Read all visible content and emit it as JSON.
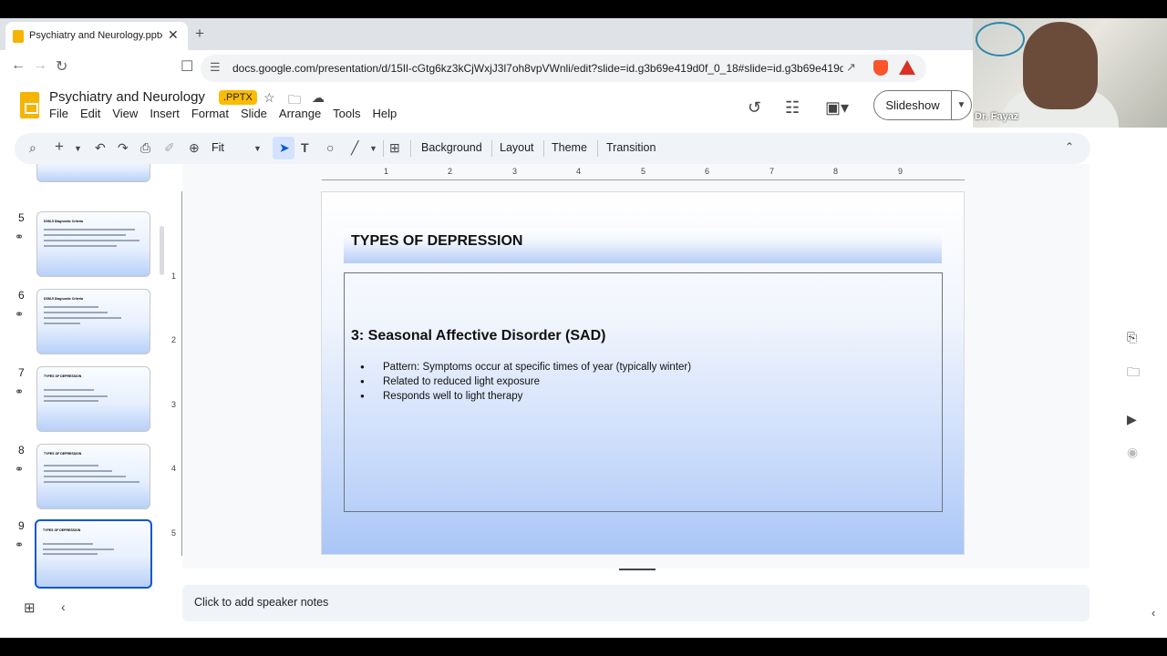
{
  "browser": {
    "tab_title": "Psychiatry and Neurology.pptx",
    "new_tab": "+",
    "close": "✕",
    "url": "docs.google.com/presentation/d/15Il-cGtg6kz3kCjWxjJ3l7oh8vpVWnli/edit?slide=id.g3b69e419d0f_0_18#slide=id.g3b69e419d...",
    "icons": [
      "back-icon",
      "forward-icon",
      "reload-icon",
      "bookmark-icon",
      "site-settings-icon",
      "share-icon",
      "brave-shields-icon",
      "brave-rewards-icon"
    ]
  },
  "docs": {
    "title": "Psychiatry and Neurology",
    "badge": ".PPTX",
    "menu": [
      "File",
      "Edit",
      "View",
      "Insert",
      "Format",
      "Slide",
      "Arrange",
      "Tools",
      "Help"
    ],
    "slideshow_label": "Slideshow"
  },
  "webcam": {
    "name": "Dr. Fayaz"
  },
  "toolbar": {
    "zoom": "Fit",
    "background": "Background",
    "layout": "Layout",
    "theme": "Theme",
    "transition": "Transition"
  },
  "filmstrip": {
    "slides": [
      {
        "num": "5",
        "title": "DSM-5 Diagnostic Criteria"
      },
      {
        "num": "6",
        "title": "DSM-5 Diagnostic Criteria"
      },
      {
        "num": "7",
        "title": "TYPES OF DEPRESSION"
      },
      {
        "num": "8",
        "title": "TYPES OF DEPRESSION"
      },
      {
        "num": "9",
        "title": "TYPES OF DEPRESSION",
        "active": true
      }
    ]
  },
  "ruler": {
    "horizontal": [
      "1",
      "2",
      "3",
      "4",
      "5",
      "6",
      "7",
      "8",
      "9"
    ],
    "vertical": [
      "1",
      "2",
      "3",
      "4",
      "5"
    ]
  },
  "slide": {
    "title": "TYPES OF DEPRESSION",
    "subtitle": "3: Seasonal Affective Disorder (SAD)",
    "bullets": [
      "Pattern: Symptoms occur at specific times of year (typically winter)",
      "Related to reduced light exposure",
      "Responds well to light therapy"
    ]
  },
  "notes": {
    "placeholder": "Click to add speaker notes"
  },
  "colors": {
    "accent": "#0b57d0",
    "slides_yellow": "#f4b400",
    "toolbar_bg": "#f0f4f9"
  }
}
